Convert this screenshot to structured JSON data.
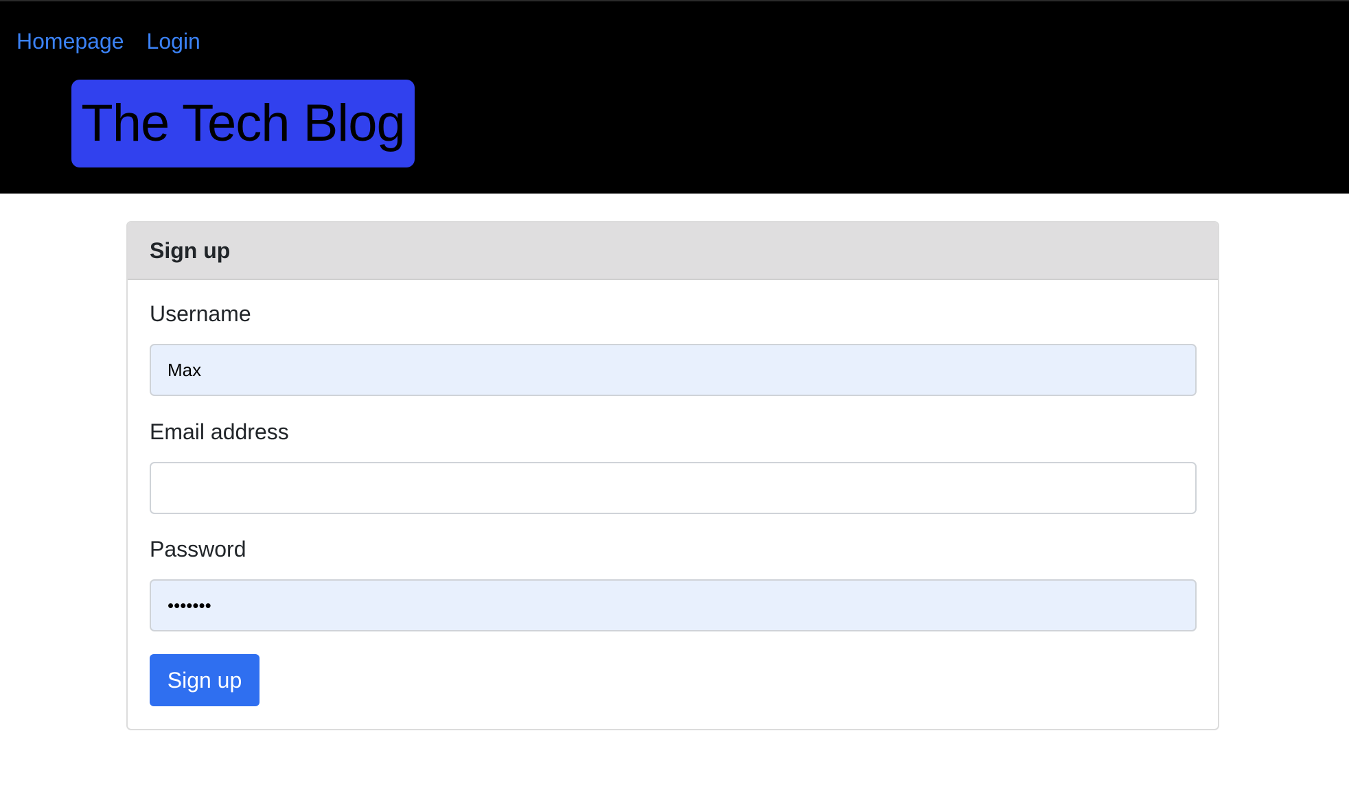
{
  "nav": {
    "links": [
      {
        "label": "Homepage"
      },
      {
        "label": "Login"
      }
    ]
  },
  "brand": {
    "title": "The Tech Blog"
  },
  "signup": {
    "header": "Sign up",
    "username_label": "Username",
    "username_value": "Max",
    "email_label": "Email address",
    "email_value": "",
    "password_label": "Password",
    "password_value": "•••••••",
    "submit_label": "Sign up"
  },
  "colors": {
    "header_bg": "#000000",
    "nav_link": "#3b82f6",
    "brand_badge": "#3141ee",
    "card_header_bg": "#dfdedf",
    "autofill_bg": "#e8f0fd",
    "button_bg": "#2f6ff0"
  }
}
